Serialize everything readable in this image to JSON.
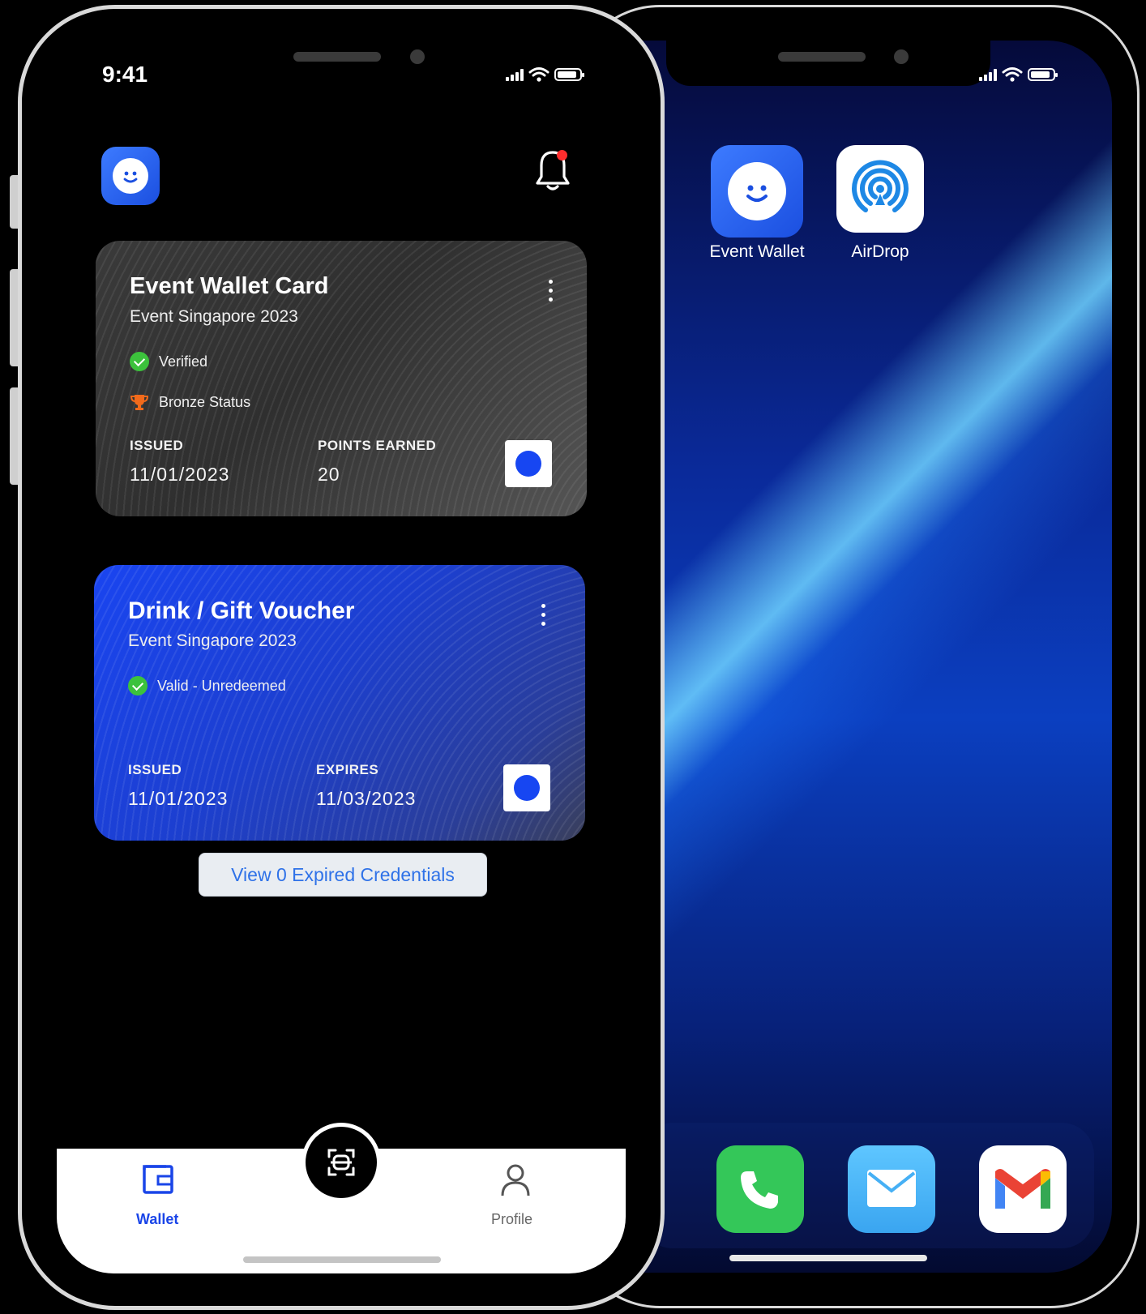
{
  "front_phone": {
    "status_bar": {
      "time": "9:41"
    },
    "header": {
      "logo_icon": "smiley-app-logo",
      "notification_icon": "bell-icon",
      "has_unread": true
    },
    "cards": [
      {
        "title": "Event Wallet Card",
        "subtitle": "Event Singapore 2023",
        "badges": [
          "Verified",
          "Bronze Status"
        ],
        "fields": [
          {
            "label": "ISSUED",
            "value": "11/01/2023"
          },
          {
            "label": "POINTS EARNED",
            "value": "20"
          }
        ]
      },
      {
        "title": "Drink / Gift Voucher",
        "subtitle": "Event Singapore 2023",
        "badges": [
          "Valid - Unredeemed"
        ],
        "fields": [
          {
            "label": "ISSUED",
            "value": "11/01/2023"
          },
          {
            "label": "EXPIRES",
            "value": "11/03/2023"
          }
        ]
      }
    ],
    "expired_button": "View 0 Expired Credentials",
    "tabbar": {
      "wallet": "Wallet",
      "profile": "Profile",
      "active": "wallet",
      "active_color": "#1a45e8"
    }
  },
  "back_phone": {
    "apps": [
      {
        "name": "Event Wallet",
        "icon": "smiley-app-logo"
      },
      {
        "name": "AirDrop",
        "icon": "airdrop-icon"
      }
    ],
    "dock": [
      "phone-icon",
      "mail-icon",
      "gmail-icon"
    ]
  },
  "colors": {
    "accent_blue": "#1a45e8",
    "verified_green": "#3cc23c",
    "link_blue": "#2f72e8"
  }
}
